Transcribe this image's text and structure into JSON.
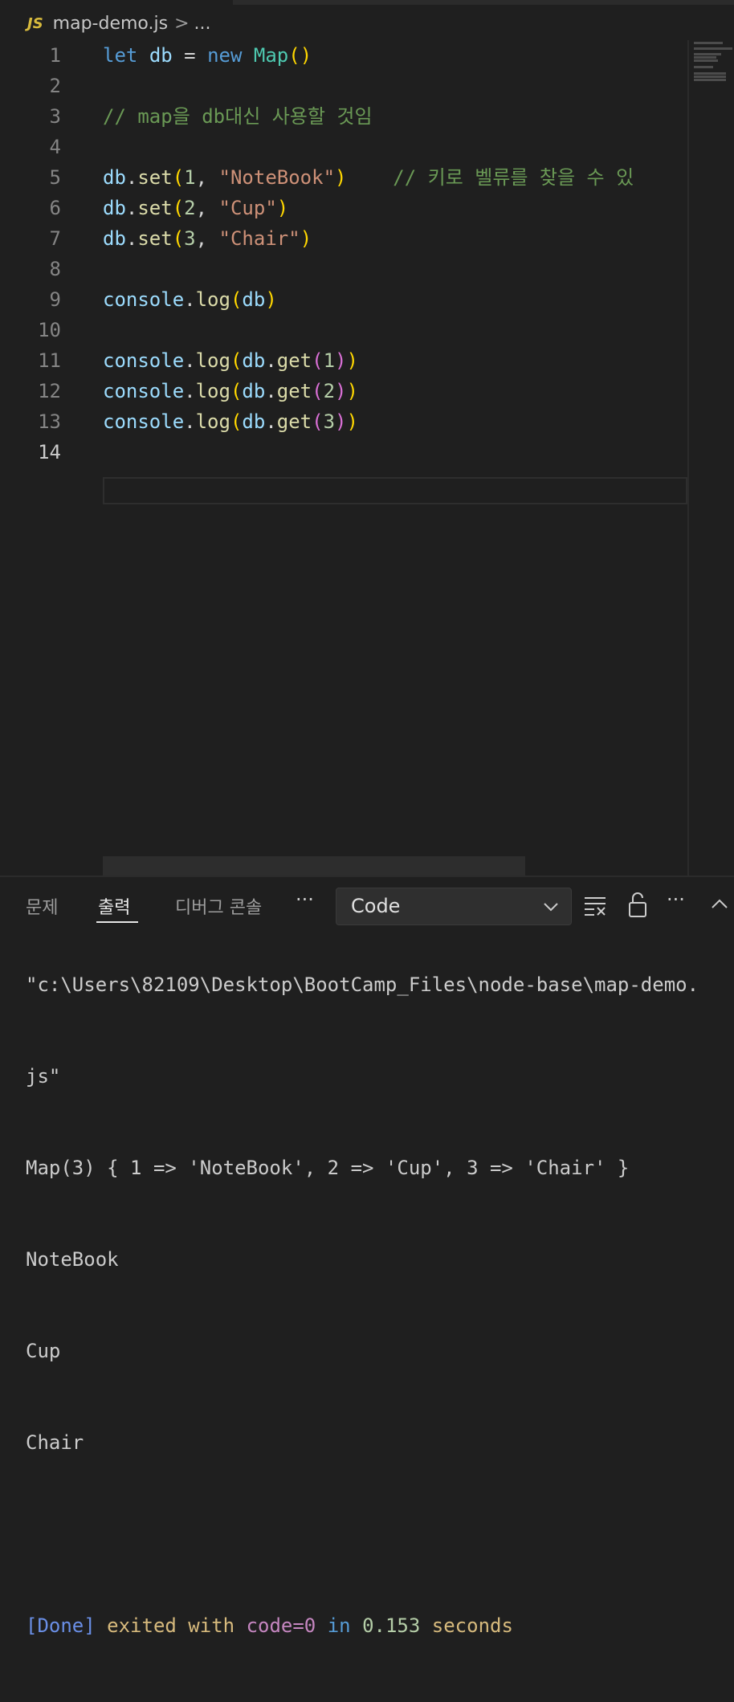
{
  "breadcrumb": {
    "icon_label": "JS",
    "file_name": "map-demo.js",
    "separator": ">",
    "more": "..."
  },
  "editor": {
    "active_line": "14",
    "lines": [
      {
        "num": "1",
        "tokens": [
          [
            "kw",
            "let"
          ],
          [
            "op",
            " "
          ],
          [
            "var",
            "db"
          ],
          [
            "op",
            " = "
          ],
          [
            "kw",
            "new"
          ],
          [
            "op",
            " "
          ],
          [
            "cls",
            "Map"
          ],
          [
            "p1",
            "()"
          ]
        ]
      },
      {
        "num": "2",
        "tokens": []
      },
      {
        "num": "3",
        "tokens": [
          [
            "cmt",
            "// map을 db대신 사용할 것임"
          ]
        ]
      },
      {
        "num": "4",
        "tokens": []
      },
      {
        "num": "5",
        "tokens": [
          [
            "var",
            "db"
          ],
          [
            "op",
            "."
          ],
          [
            "fn",
            "set"
          ],
          [
            "p1",
            "("
          ],
          [
            "num",
            "1"
          ],
          [
            "op",
            ", "
          ],
          [
            "str",
            "\"NoteBook\""
          ],
          [
            "p1",
            ")"
          ],
          [
            "op",
            "    "
          ],
          [
            "cmt",
            "// 키로 벨류를 찾을 수 있"
          ]
        ]
      },
      {
        "num": "6",
        "tokens": [
          [
            "var",
            "db"
          ],
          [
            "op",
            "."
          ],
          [
            "fn",
            "set"
          ],
          [
            "p1",
            "("
          ],
          [
            "num",
            "2"
          ],
          [
            "op",
            ", "
          ],
          [
            "str",
            "\"Cup\""
          ],
          [
            "p1",
            ")"
          ]
        ]
      },
      {
        "num": "7",
        "tokens": [
          [
            "var",
            "db"
          ],
          [
            "op",
            "."
          ],
          [
            "fn",
            "set"
          ],
          [
            "p1",
            "("
          ],
          [
            "num",
            "3"
          ],
          [
            "op",
            ", "
          ],
          [
            "str",
            "\"Chair\""
          ],
          [
            "p1",
            ")"
          ]
        ]
      },
      {
        "num": "8",
        "tokens": []
      },
      {
        "num": "9",
        "tokens": [
          [
            "var",
            "console"
          ],
          [
            "op",
            "."
          ],
          [
            "fn",
            "log"
          ],
          [
            "p1",
            "("
          ],
          [
            "var",
            "db"
          ],
          [
            "p1",
            ")"
          ]
        ]
      },
      {
        "num": "10",
        "tokens": []
      },
      {
        "num": "11",
        "tokens": [
          [
            "var",
            "console"
          ],
          [
            "op",
            "."
          ],
          [
            "fn",
            "log"
          ],
          [
            "p1",
            "("
          ],
          [
            "var",
            "db"
          ],
          [
            "op",
            "."
          ],
          [
            "fn",
            "get"
          ],
          [
            "p2",
            "("
          ],
          [
            "num",
            "1"
          ],
          [
            "p2",
            ")"
          ],
          [
            "p1",
            ")"
          ]
        ]
      },
      {
        "num": "12",
        "tokens": [
          [
            "var",
            "console"
          ],
          [
            "op",
            "."
          ],
          [
            "fn",
            "log"
          ],
          [
            "p1",
            "("
          ],
          [
            "var",
            "db"
          ],
          [
            "op",
            "."
          ],
          [
            "fn",
            "get"
          ],
          [
            "p2",
            "("
          ],
          [
            "num",
            "2"
          ],
          [
            "p2",
            ")"
          ],
          [
            "p1",
            ")"
          ]
        ]
      },
      {
        "num": "13",
        "tokens": [
          [
            "var",
            "console"
          ],
          [
            "op",
            "."
          ],
          [
            "fn",
            "log"
          ],
          [
            "p1",
            "("
          ],
          [
            "var",
            "db"
          ],
          [
            "op",
            "."
          ],
          [
            "fn",
            "get"
          ],
          [
            "p2",
            "("
          ],
          [
            "num",
            "3"
          ],
          [
            "p2",
            ")"
          ],
          [
            "p1",
            ")"
          ]
        ]
      },
      {
        "num": "14",
        "tokens": []
      }
    ]
  },
  "panel": {
    "tabs": [
      {
        "label": "문제",
        "active": false
      },
      {
        "label": "출력",
        "active": true
      },
      {
        "label": "디버그 콘솔",
        "active": false
      }
    ],
    "more_label": "···",
    "dropdown_value": "Code",
    "actions_more": "···",
    "output": {
      "path_line": "\"c:\\Users\\82109\\Desktop\\BootCamp_Files\\node-base\\map-demo.",
      "path_cont": "js\"",
      "map_line": "Map(3) { 1 => 'NoteBook', 2 => 'Cup', 3 => 'Chair' }",
      "values": [
        "NoteBook",
        "Cup",
        "Chair"
      ],
      "done_tag": "[Done]",
      "done_text1": "exited with",
      "done_code": "code=0",
      "done_in": "in",
      "done_time": "0.153",
      "done_seconds": "seconds"
    }
  }
}
